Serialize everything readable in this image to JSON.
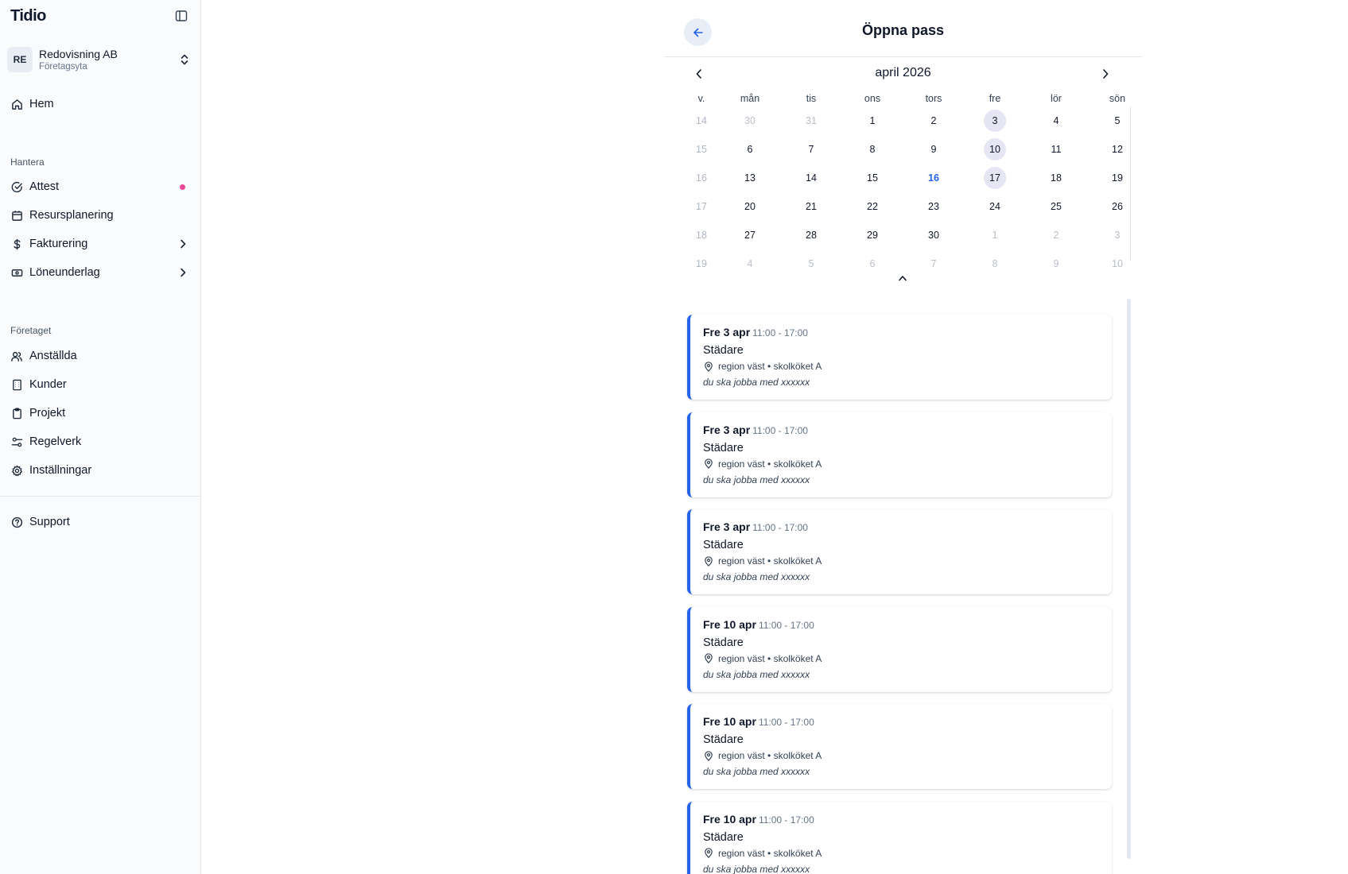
{
  "sidebar": {
    "brand": "Tidio",
    "org": {
      "initials": "RE",
      "name": "Redovisning AB",
      "subtitle": "Företagsyta"
    },
    "items": {
      "home": "Hem",
      "attest": "Attest",
      "resource": "Resursplanering",
      "invoicing": "Fakturering",
      "payroll": "Löneunderlag",
      "employees": "Anställda",
      "customers": "Kunder",
      "projects": "Projekt",
      "rules": "Regelverk",
      "settings": "Inställningar",
      "support": "Support"
    },
    "sections": {
      "manage": "Hantera",
      "company": "Företaget"
    },
    "colors": {
      "notification_dot": "#ec4899"
    }
  },
  "panel": {
    "title": "Öppna pass",
    "colors": {
      "accent": "#2563eb",
      "shift_day": "#e6e5f3"
    }
  },
  "calendar": {
    "month_label": "april 2026",
    "headers": [
      "v.",
      "mån",
      "tis",
      "ons",
      "tors",
      "fre",
      "lör",
      "sön"
    ],
    "weeks": [
      {
        "week": "14",
        "days": [
          {
            "d": "30",
            "muted": true
          },
          {
            "d": "31",
            "muted": true
          },
          {
            "d": "1"
          },
          {
            "d": "2"
          },
          {
            "d": "3",
            "shift": true
          },
          {
            "d": "4"
          },
          {
            "d": "5"
          }
        ]
      },
      {
        "week": "15",
        "days": [
          {
            "d": "6"
          },
          {
            "d": "7"
          },
          {
            "d": "8"
          },
          {
            "d": "9"
          },
          {
            "d": "10",
            "shift": true
          },
          {
            "d": "11"
          },
          {
            "d": "12"
          }
        ]
      },
      {
        "week": "16",
        "days": [
          {
            "d": "13"
          },
          {
            "d": "14"
          },
          {
            "d": "15"
          },
          {
            "d": "16",
            "today": true
          },
          {
            "d": "17",
            "shift": true
          },
          {
            "d": "18"
          },
          {
            "d": "19"
          }
        ]
      },
      {
        "week": "17",
        "days": [
          {
            "d": "20"
          },
          {
            "d": "21"
          },
          {
            "d": "22"
          },
          {
            "d": "23"
          },
          {
            "d": "24"
          },
          {
            "d": "25"
          },
          {
            "d": "26"
          }
        ]
      },
      {
        "week": "18",
        "days": [
          {
            "d": "27"
          },
          {
            "d": "28"
          },
          {
            "d": "29"
          },
          {
            "d": "30"
          },
          {
            "d": "1",
            "muted": true
          },
          {
            "d": "2",
            "muted": true
          },
          {
            "d": "3",
            "muted": true
          }
        ]
      },
      {
        "week": "19",
        "days": [
          {
            "d": "4",
            "muted": true
          },
          {
            "d": "5",
            "muted": true
          },
          {
            "d": "6",
            "muted": true
          },
          {
            "d": "7",
            "muted": true
          },
          {
            "d": "8",
            "muted": true
          },
          {
            "d": "9",
            "muted": true
          },
          {
            "d": "10",
            "muted": true
          }
        ]
      }
    ]
  },
  "shifts": [
    {
      "date": "Fre 3 apr",
      "time": "11:00 - 17:00",
      "role": "Städare",
      "location": "region väst • skolköket A",
      "note": "du ska jobba med xxxxxx"
    },
    {
      "date": "Fre 3 apr",
      "time": "11:00 - 17:00",
      "role": "Städare",
      "location": "region väst • skolköket A",
      "note": "du ska jobba med xxxxxx"
    },
    {
      "date": "Fre 3 apr",
      "time": "11:00 - 17:00",
      "role": "Städare",
      "location": "region väst • skolköket A",
      "note": "du ska jobba med xxxxxx"
    },
    {
      "date": "Fre 10 apr",
      "time": "11:00 - 17:00",
      "role": "Städare",
      "location": "region väst • skolköket A",
      "note": "du ska jobba med xxxxxx"
    },
    {
      "date": "Fre 10 apr",
      "time": "11:00 - 17:00",
      "role": "Städare",
      "location": "region väst • skolköket A",
      "note": "du ska jobba med xxxxxx"
    },
    {
      "date": "Fre 10 apr",
      "time": "11:00 - 17:00",
      "role": "Städare",
      "location": "region väst • skolköket A",
      "note": "du ska jobba med xxxxxx"
    }
  ]
}
